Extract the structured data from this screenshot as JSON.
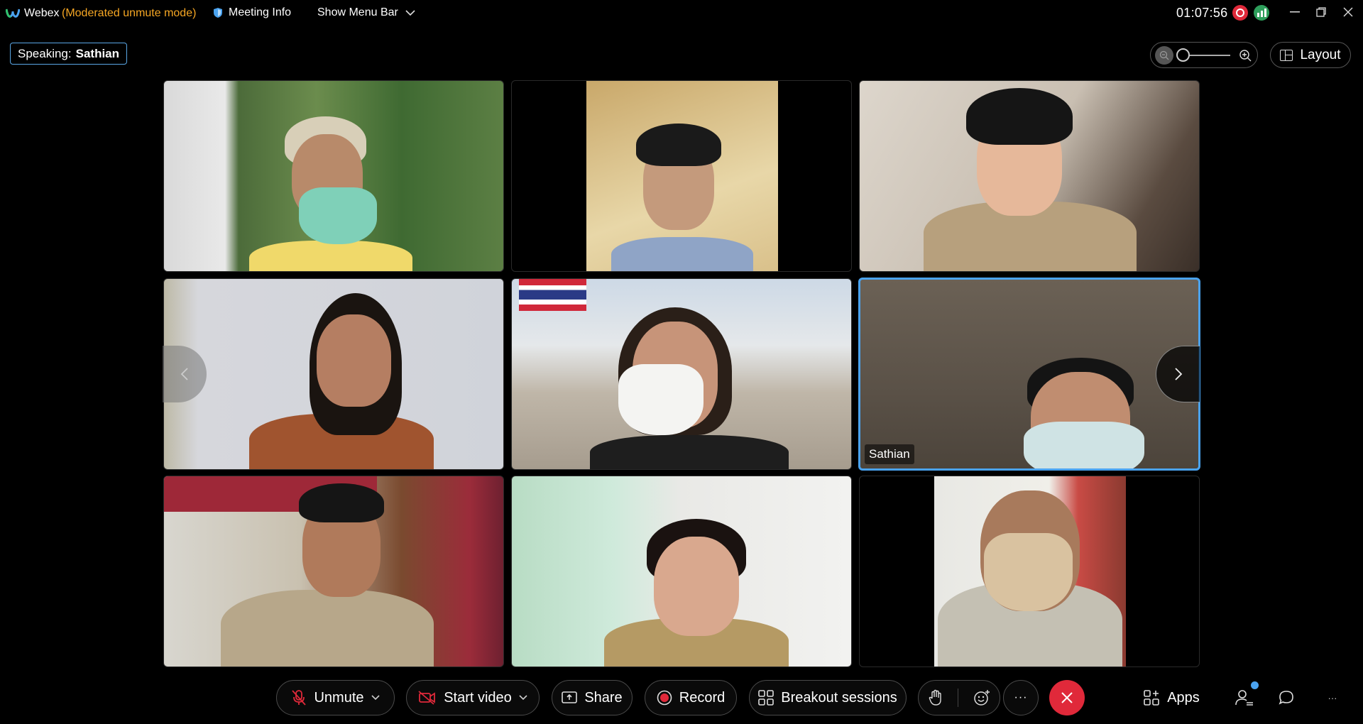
{
  "titlebar": {
    "app_name": "Webex",
    "mode": "(Moderated unmute mode)",
    "meeting_info": "Meeting Info",
    "show_menu_bar": "Show Menu Bar",
    "clock": "01:07:56"
  },
  "speaking": {
    "label": "Speaking:",
    "name": "Sathian"
  },
  "zoom": {
    "out_icon": "zoom-out-icon",
    "in_icon": "zoom-in-icon",
    "level": 0
  },
  "layout_button": "Layout",
  "participants": [
    {
      "name": ""
    },
    {
      "name": ""
    },
    {
      "name": ""
    },
    {
      "name": ""
    },
    {
      "name": ""
    },
    {
      "name": "Sathian",
      "active": true
    },
    {
      "name": ""
    },
    {
      "name": ""
    },
    {
      "name": ""
    }
  ],
  "toolbar": {
    "unmute": "Unmute",
    "start_video": "Start video",
    "share": "Share",
    "record": "Record",
    "breakout": "Breakout sessions",
    "more": "···",
    "apps": "Apps",
    "overflow": "···"
  },
  "colors": {
    "accent": "#4aa3f0",
    "mode_text": "#f5a623",
    "end_call": "#e0293a",
    "unmute_icon": "#e0293a"
  }
}
